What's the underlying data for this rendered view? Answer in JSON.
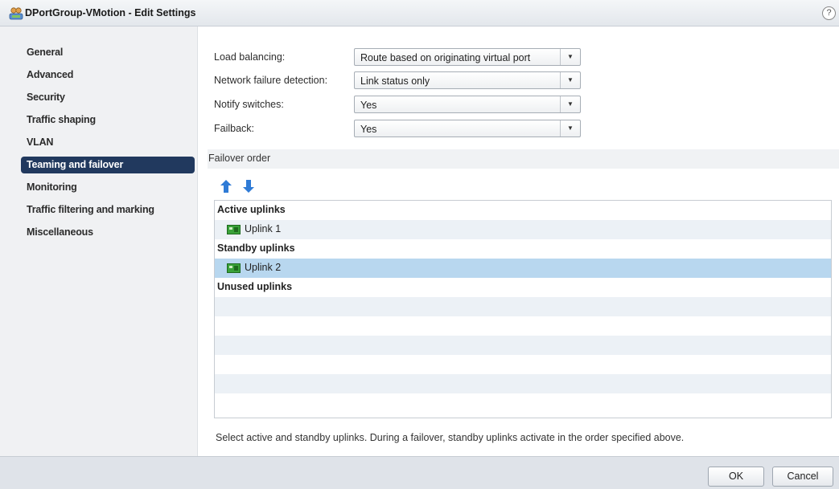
{
  "window": {
    "title": "DPortGroup-VMotion - Edit Settings",
    "help_glyph": "?"
  },
  "sidebar": {
    "items": [
      {
        "label": "General"
      },
      {
        "label": "Advanced"
      },
      {
        "label": "Security"
      },
      {
        "label": "Traffic shaping"
      },
      {
        "label": "VLAN"
      },
      {
        "label": "Teaming and failover",
        "active": true
      },
      {
        "label": "Monitoring"
      },
      {
        "label": "Traffic filtering and marking"
      },
      {
        "label": "Miscellaneous"
      }
    ]
  },
  "form": {
    "load_balancing": {
      "label": "Load balancing:",
      "value": "Route based on originating virtual port"
    },
    "network_failure_detection": {
      "label": "Network failure detection:",
      "value": "Link status only"
    },
    "notify_switches": {
      "label": "Notify switches:",
      "value": "Yes"
    },
    "failback": {
      "label": "Failback:",
      "value": "Yes"
    }
  },
  "failover": {
    "section_title": "Failover order",
    "move_up_icon": "arrow-up-icon",
    "move_down_icon": "arrow-down-icon",
    "groups": [
      {
        "label": "Active uplinks",
        "uplinks": [
          {
            "label": "Uplink 1",
            "selected": false
          }
        ]
      },
      {
        "label": "Standby uplinks",
        "uplinks": [
          {
            "label": "Uplink 2",
            "selected": true
          }
        ]
      },
      {
        "label": "Unused uplinks",
        "uplinks": []
      }
    ],
    "hint": "Select active and standby uplinks. During a failover, standby uplinks activate in the order specified above."
  },
  "footer": {
    "ok_label": "OK",
    "cancel_label": "Cancel"
  },
  "colors": {
    "nav_active": "#21395e",
    "selected_row": "#b8d7ef",
    "alt_row": "#ecf1f6",
    "arrow_blue": "#2f7bd6",
    "nic_green": "#3aa23a"
  }
}
